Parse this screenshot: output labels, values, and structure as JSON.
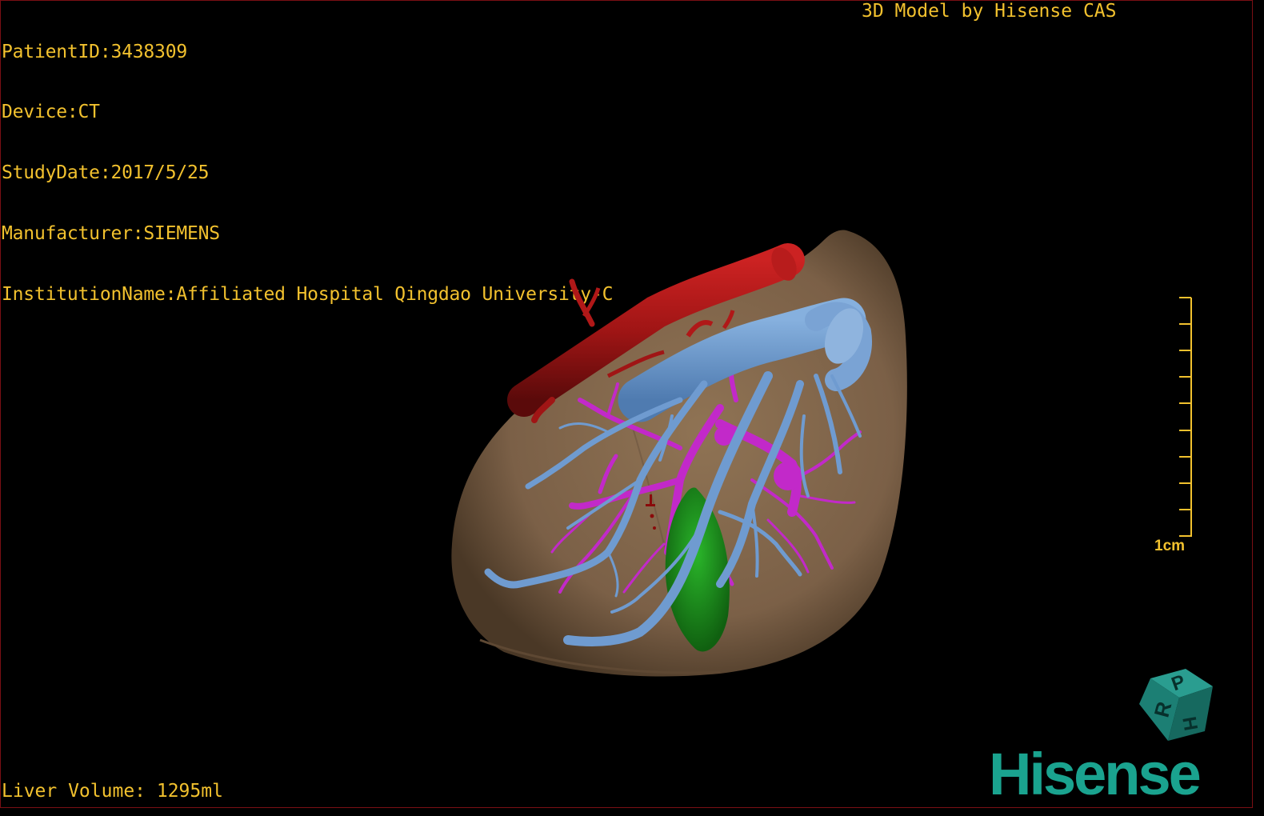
{
  "study_info": {
    "patient_id": "PatientID:3438309",
    "device": "Device:CT",
    "study_date": "StudyDate:2017/5/25",
    "manufacturer": "Manufacturer:SIEMENS",
    "institution": "InstitutionName:Affiliated Hospital Qingdao University-C"
  },
  "credit": "3D Model by Hisense CAS",
  "liver_volume": "Liver Volume: 1295ml",
  "scale_bar": {
    "label": "1cm",
    "ticks": 10
  },
  "brand": {
    "name": "Hisense",
    "cube_letters": [
      "P",
      "H",
      "R"
    ],
    "color": "#1aa38f"
  },
  "colors": {
    "text": "#f2c12e",
    "liver": "#8a6d4f",
    "aorta": "#b01818",
    "portal_vein": "#6f9bd0",
    "hepatic_artery": "#c229c9",
    "gallbladder": "#1e9a1e",
    "background": "#000000"
  },
  "structures": [
    "liver",
    "aorta",
    "hepatic-vein",
    "portal-vein",
    "gallbladder"
  ]
}
